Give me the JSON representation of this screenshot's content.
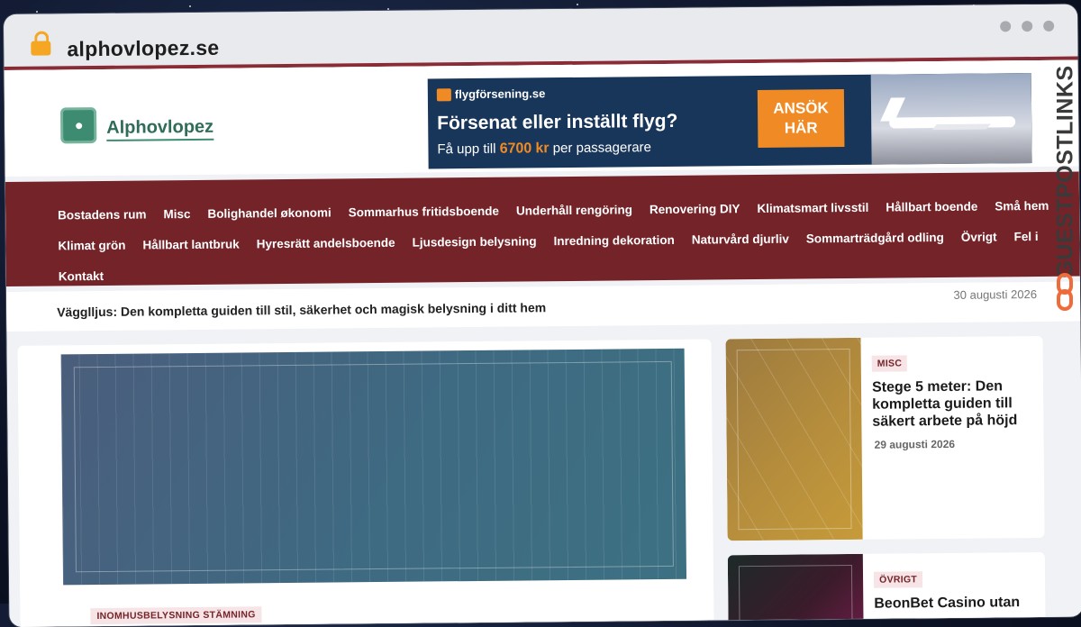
{
  "browser": {
    "url": "alphovlopez.se"
  },
  "logo": {
    "name": "Alphovlopez"
  },
  "ad": {
    "brand": "flygförsening.se",
    "headline": "Försenat eller inställt flyg?",
    "sub_prefix": "Få upp till",
    "amount": "6700",
    "currency": "kr",
    "sub_suffix": "per passagerare",
    "cta_line1": "ANSÖK",
    "cta_line2": "HÄR"
  },
  "nav": {
    "row1": [
      "Bostadens rum",
      "Misc",
      "Bolighandel økonomi",
      "Sommarhus fritidsboende",
      "Underhåll rengöring",
      "Renovering DIY",
      "Klimatsmart livsstil",
      "Hållbart boende",
      "Små hem"
    ],
    "row2": [
      "Klimat grön",
      "Hållbart lantbruk",
      "Hyresrätt andelsboende",
      "Ljusdesign belysning",
      "Inredning dekoration",
      "Naturvård djurliv",
      "Sommarträdgård odling",
      "Övrigt",
      "Fel i"
    ],
    "row3": [
      "Kontakt"
    ]
  },
  "ticker": {
    "title": "Vägglljus: Den kompletta guiden till stil, säkerhet och magisk belysning i ditt hem",
    "date": "30 augusti 2026"
  },
  "main": {
    "category": "INOMHUSBELYSNING STÄMNING"
  },
  "sidebar": [
    {
      "category": "MISC",
      "title": "Stege 5 meter: Den kompletta guiden till säkert arbete på höjd",
      "date": "29 augusti 2026"
    },
    {
      "category": "ÖVRIGT",
      "title": "BeonBet Casino utan"
    }
  ],
  "watermark": {
    "text": "GUESTPOSTLINKS"
  },
  "colors": {
    "accent": "#742429",
    "brand_green": "#3d8b71",
    "ad_orange": "#f08a24",
    "ad_navy": "#18365a"
  }
}
